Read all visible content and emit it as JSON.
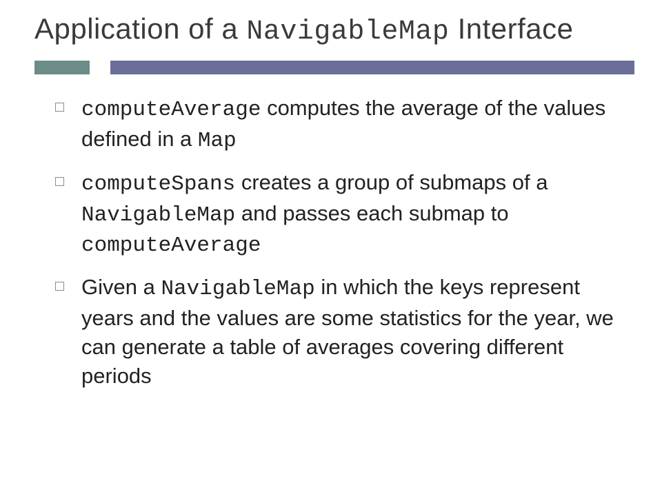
{
  "title": {
    "pre": "Application of a ",
    "code": "NavigableMap",
    "post": " Interface"
  },
  "bullets": [
    {
      "code1": "computeAverage",
      "t1": " computes the average of the values defined in a ",
      "code2": "Map",
      "t2": ""
    },
    {
      "code1": "computeSpans",
      "t1": " creates a group of submaps of a ",
      "code2": "NavigableMap",
      "t2": " and passes each submap to ",
      "code3": "computeAverage",
      "t3": ""
    },
    {
      "t0": "Given a ",
      "code1": "NavigableMap",
      "t1": " in which the keys represent years and the values are some statistics for the year, we can generate a table of averages covering different periods"
    }
  ]
}
